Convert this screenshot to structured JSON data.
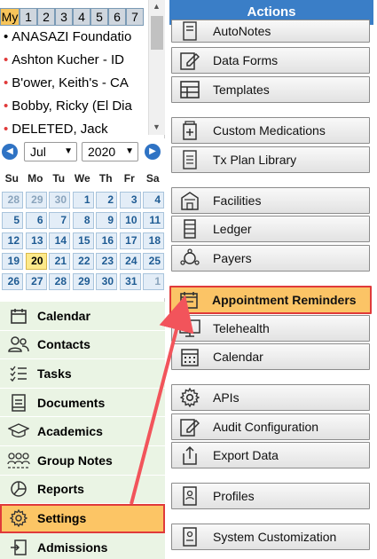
{
  "tabs": [
    "My",
    "1",
    "2",
    "3",
    "4",
    "5",
    "6",
    "7"
  ],
  "clients": [
    {
      "bullet": "•",
      "name": "ANASAZI Foundatio",
      "color": "#000000"
    },
    {
      "bullet": "•",
      "name": "Ashton Kucher - ID",
      "color": "#e03a3a"
    },
    {
      "bullet": "•",
      "name": "B'ower, Keith's - CA",
      "color": "#e03a3a"
    },
    {
      "bullet": "•",
      "name": "Bobby, Ricky (El Dia",
      "color": "#e03a3a"
    },
    {
      "bullet": "•",
      "name": "DELETED, Jack",
      "color": "#e03a3a"
    }
  ],
  "calendar": {
    "month": "Jul",
    "year": "2020",
    "weekdays": [
      "Su",
      "Mo",
      "Tu",
      "We",
      "Th",
      "Fr",
      "Sa"
    ],
    "days": [
      [
        "28",
        "29",
        "30",
        "1",
        "2",
        "3",
        "4"
      ],
      [
        "5",
        "6",
        "7",
        "8",
        "9",
        "10",
        "11"
      ],
      [
        "12",
        "13",
        "14",
        "15",
        "16",
        "17",
        "18"
      ],
      [
        "19",
        "20",
        "21",
        "22",
        "23",
        "24",
        "25"
      ],
      [
        "26",
        "27",
        "28",
        "29",
        "30",
        "31",
        "1"
      ]
    ],
    "today": "20"
  },
  "nav": [
    {
      "label": "Calendar",
      "icon": "calendar-icon"
    },
    {
      "label": "Contacts",
      "icon": "contacts-icon"
    },
    {
      "label": "Tasks",
      "icon": "tasks-icon"
    },
    {
      "label": "Documents",
      "icon": "documents-icon"
    },
    {
      "label": "Academics",
      "icon": "graduation-cap-icon"
    },
    {
      "label": "Group Notes",
      "icon": "group-icon"
    },
    {
      "label": "Reports",
      "icon": "pie-chart-icon"
    },
    {
      "label": "Settings",
      "icon": "gear-icon"
    },
    {
      "label": "Admissions",
      "icon": "admissions-icon"
    }
  ],
  "actions": {
    "title": "Actions",
    "buttons": [
      {
        "label": "AutoNotes",
        "icon": "notes-icon"
      },
      {
        "label": "Data Forms",
        "icon": "form-edit-icon"
      },
      {
        "label": "Templates",
        "icon": "template-icon"
      },
      {
        "label": "Custom Medications",
        "icon": "medication-icon"
      },
      {
        "label": "Tx Plan Library",
        "icon": "library-icon"
      },
      {
        "label": "Facilities",
        "icon": "building-icon"
      },
      {
        "label": "Ledger",
        "icon": "ledger-icon"
      },
      {
        "label": "Payers",
        "icon": "payers-icon"
      },
      {
        "label": "Appointment Reminders",
        "icon": "reminder-icon"
      },
      {
        "label": "Telehealth",
        "icon": "monitor-icon"
      },
      {
        "label": "Calendar",
        "icon": "calendar-grid-icon"
      },
      {
        "label": "APIs",
        "icon": "gear-icon"
      },
      {
        "label": "Audit Configuration",
        "icon": "audit-icon"
      },
      {
        "label": "Export Data",
        "icon": "export-icon"
      },
      {
        "label": "Profiles",
        "icon": "profile-icon"
      },
      {
        "label": "System Customization",
        "icon": "customization-icon"
      }
    ]
  }
}
